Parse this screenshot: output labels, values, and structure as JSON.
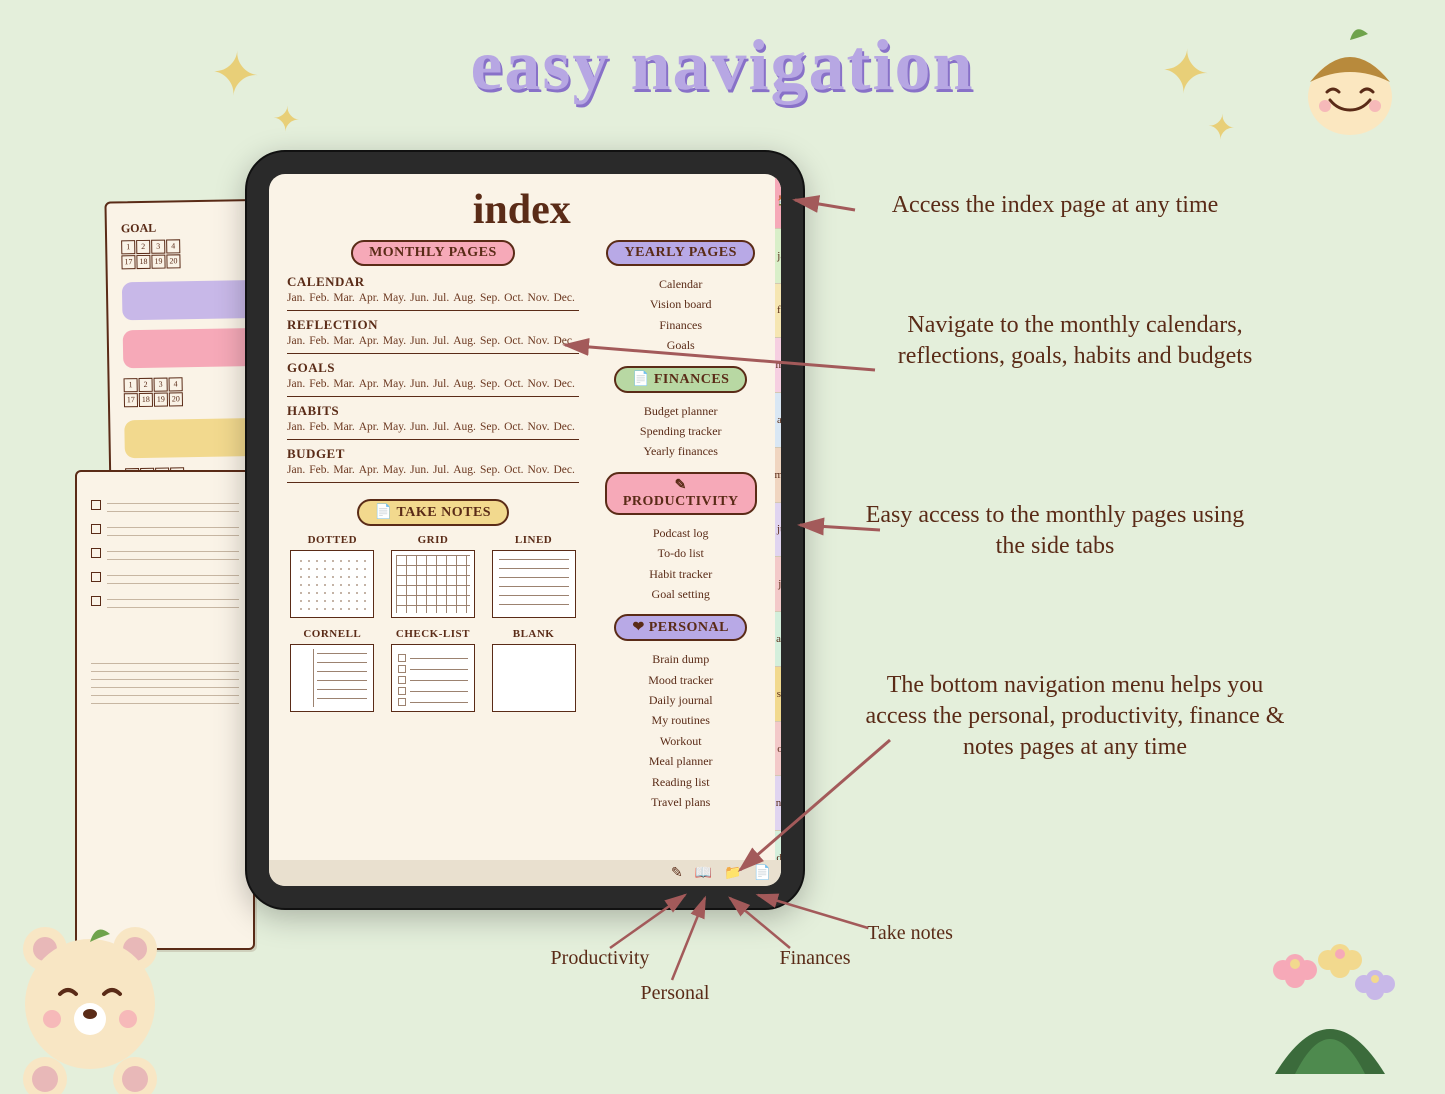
{
  "title": "easy navigation",
  "page_title": "index",
  "pills": {
    "monthly": "MONTHLY PAGES",
    "yearly": "YEARLY PAGES",
    "finances": "📄 FINANCES",
    "productivity": "✎ PRODUCTIVITY",
    "personal": "❤ PERSONAL",
    "take_notes": "📄 TAKE NOTES"
  },
  "monthly_sections": [
    {
      "title": "CALENDAR"
    },
    {
      "title": "REFLECTION"
    },
    {
      "title": "GOALS"
    },
    {
      "title": "HABITS"
    },
    {
      "title": "BUDGET"
    }
  ],
  "months": [
    "Jan.",
    "Feb.",
    "Mar.",
    "Apr.",
    "May.",
    "Jun.",
    "Jul.",
    "Aug.",
    "Sep.",
    "Oct.",
    "Nov.",
    "Dec."
  ],
  "yearly_items": [
    "Calendar",
    "Vision board",
    "Finances",
    "Goals"
  ],
  "finance_items": [
    "Budget planner",
    "Spending tracker",
    "Yearly finances"
  ],
  "productivity_items": [
    "Podcast log",
    "To-do list",
    "Habit tracker",
    "Goal setting"
  ],
  "personal_items": [
    "Brain dump",
    "Mood tracker",
    "Daily journal",
    "My routines",
    "Workout",
    "Meal planner",
    "Reading list",
    "Travel plans"
  ],
  "note_types": [
    "DOTTED",
    "GRID",
    "LINED",
    "CORNELL",
    "CHECK-LIST",
    "BLANK"
  ],
  "side_tabs": [
    "jan",
    "feb",
    "mar",
    "apr",
    "may",
    "jun",
    "jul",
    "aug",
    "sep",
    "oct",
    "nov",
    "dec"
  ],
  "callouts": {
    "index": "Access the index page at any time",
    "monthly": "Navigate to the monthly calendars, reflections, goals, habits and budgets",
    "side": "Easy access to the monthly pages using the side tabs",
    "bottom": "The bottom navigation menu helps you access the personal, productivity, finance & notes pages at any time"
  },
  "bottom_labels": {
    "productivity": "Productivity",
    "personal": "Personal",
    "finances": "Finances",
    "notes": "Take notes"
  },
  "back_page_label": "GOAL"
}
